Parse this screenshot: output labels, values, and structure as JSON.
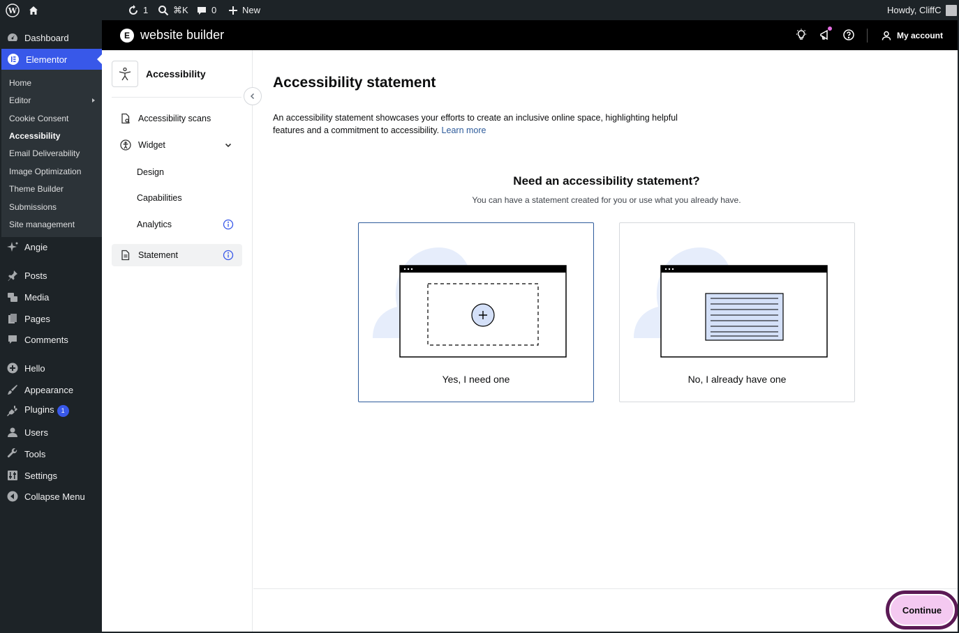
{
  "admin_bar": {
    "updates_count": "1",
    "search_shortcut": "⌘K",
    "comments_count": "0",
    "new_label": "New",
    "greeting": "Howdy, CliffC"
  },
  "sidebar": {
    "dashboard": "Dashboard",
    "elementor": "Elementor",
    "submenu": {
      "home": "Home",
      "editor": "Editor",
      "cookie_consent": "Cookie Consent",
      "accessibility": "Accessibility",
      "email_deliverability": "Email Deliverability",
      "image_optimization": "Image Optimization",
      "theme_builder": "Theme Builder",
      "submissions": "Submissions",
      "site_management": "Site management"
    },
    "angie": "Angie",
    "posts": "Posts",
    "media": "Media",
    "pages": "Pages",
    "comments": "Comments",
    "hello": "Hello",
    "appearance": "Appearance",
    "plugins": "Plugins",
    "plugins_badge": "1",
    "users": "Users",
    "tools": "Tools",
    "settings": "Settings",
    "collapse": "Collapse Menu"
  },
  "topbar": {
    "brand": "website builder",
    "account": "My account"
  },
  "panel": {
    "title": "Accessibility",
    "scans": "Accessibility scans",
    "widget": "Widget",
    "design": "Design",
    "capabilities": "Capabilities",
    "analytics": "Analytics",
    "statement": "Statement"
  },
  "main": {
    "title": "Accessibility statement",
    "description": "An accessibility statement showcases your efforts to create an inclusive online space, highlighting helpful features and a commitment to accessibility.",
    "learn_more": "Learn more",
    "question": "Need an accessibility statement?",
    "question_sub": "You can have a statement created for you or use what you already have.",
    "option_yes": "Yes, I need one",
    "option_no": "No, I already have one",
    "continue": "Continue"
  },
  "colors": {
    "wp_dark": "#1d2327",
    "wp_accent": "#3858e9",
    "continue_bg": "#f4c9f1",
    "continue_ring": "#5b1a55",
    "selected_border": "#2d5b9b"
  }
}
